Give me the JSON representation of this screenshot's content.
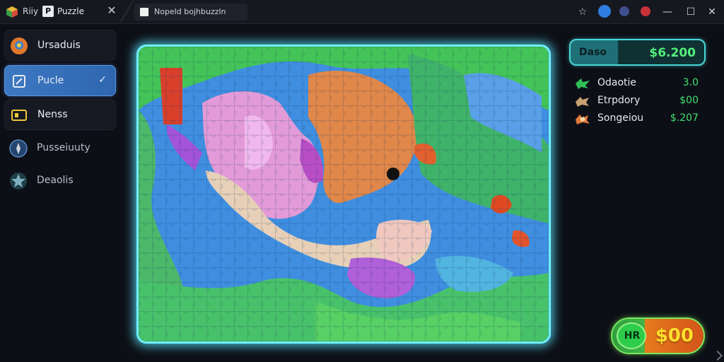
{
  "titlebar": {
    "app_title": "Riiy",
    "app_name": "Puzzle",
    "close_glyph": "✕",
    "tab_label": "Nopeld bojhbuzzln",
    "icons": [
      "star-icon",
      "extension-icon",
      "profile-icon",
      "settings-icon"
    ],
    "minimize_glyph": "—",
    "maximize_glyph": "☐",
    "window_close_glyph": "✕"
  },
  "sidebar": {
    "items": [
      {
        "label": "Ursaduis",
        "icon": "pin-icon"
      },
      {
        "label": "Pucle",
        "icon": "puzzle-icon",
        "chevron": "✓"
      },
      {
        "label": "Nenss",
        "icon": "tile-icon"
      },
      {
        "label": "Pusseiuuty",
        "icon": "compass-icon"
      },
      {
        "label": "Deaolis",
        "icon": "star-icon"
      }
    ]
  },
  "score": {
    "label": "Daso",
    "value": "$6.200"
  },
  "stats": [
    {
      "label": "Odaotie",
      "value": "3.0",
      "icon": "green-piece-icon"
    },
    {
      "label": "Etrpdory",
      "value": "$00",
      "icon": "tan-piece-icon"
    },
    {
      "label": "Songeiou",
      "value": "$.207",
      "icon": "mixed-piece-icon"
    }
  ],
  "action_button": {
    "left_label": "HR",
    "value": "$00"
  },
  "colors": {
    "accent_cyan": "#6ff0ff",
    "active_nav": "#3d78c2",
    "stat_green": "#3fe070",
    "coin_yellow": "#ffde2e"
  }
}
